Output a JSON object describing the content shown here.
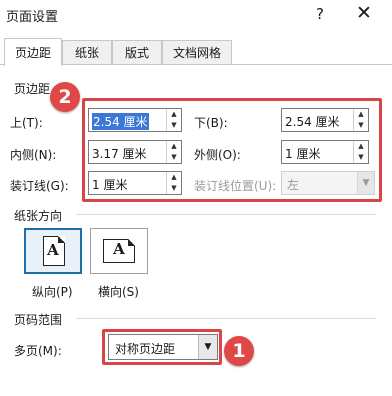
{
  "window": {
    "title": "页面设置",
    "help": "?",
    "close": "✕"
  },
  "tabs": [
    {
      "label": "页边距",
      "active": true
    },
    {
      "label": "纸张",
      "active": false
    },
    {
      "label": "版式",
      "active": false
    },
    {
      "label": "文档网格",
      "active": false
    }
  ],
  "margins": {
    "section_label": "页边距",
    "top_label": "上(T):",
    "top_value": "2.54 厘米",
    "bottom_label": "下(B):",
    "bottom_value": "2.54 厘米",
    "inside_label": "内侧(N):",
    "inside_value": "3.17 厘米",
    "outside_label": "外侧(O):",
    "outside_value": "1 厘米",
    "gutter_label": "装订线(G):",
    "gutter_value": "1 厘米",
    "gutter_pos_label": "装订线位置(U):",
    "gutter_pos_value": "左"
  },
  "orientation": {
    "section_label": "纸张方向",
    "portrait_label": "纵向(P)",
    "landscape_label": "横向(S)",
    "glyph": "A",
    "selected": "portrait"
  },
  "pages": {
    "section_label": "页码范围",
    "multiple_label": "多页(M):",
    "multiple_value": "对称页边距"
  },
  "annotations": {
    "badge1": "1",
    "badge2": "2",
    "color": "#e04848"
  },
  "icons": {
    "spin_up": "▲",
    "spin_down": "▼",
    "dropdown": "▼"
  }
}
